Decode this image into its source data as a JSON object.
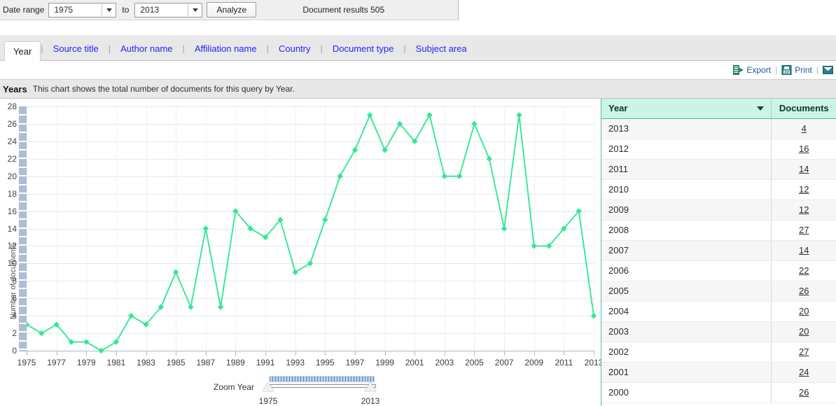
{
  "topbar": {
    "date_range_label": "Date range",
    "from_value": "1975",
    "to_label": "to",
    "to_value": "2013",
    "analyze_label": "Analyze",
    "results_text": "Document results 505"
  },
  "tabs": [
    {
      "label": "Year",
      "active": true
    },
    {
      "label": "Source title",
      "active": false
    },
    {
      "label": "Author name",
      "active": false
    },
    {
      "label": "Affiliation name",
      "active": false
    },
    {
      "label": "Country",
      "active": false
    },
    {
      "label": "Document type",
      "active": false
    },
    {
      "label": "Subject area",
      "active": false
    }
  ],
  "actions": [
    {
      "label": "Export",
      "icon": "export-icon"
    },
    {
      "label": "Print",
      "icon": "print-icon"
    },
    {
      "label": "",
      "icon": "email-icon"
    }
  ],
  "section": {
    "title": "Years",
    "description": "This chart shows the total number of documents for this query by Year."
  },
  "zoom_slider": {
    "label": "Zoom Year",
    "start_label": "1975",
    "end_label": "2013"
  },
  "table": {
    "columns": [
      "Year",
      "Documents"
    ],
    "rows": [
      {
        "year": "2013",
        "documents": "4"
      },
      {
        "year": "2012",
        "documents": "16"
      },
      {
        "year": "2011",
        "documents": "14"
      },
      {
        "year": "2010",
        "documents": "12"
      },
      {
        "year": "2009",
        "documents": "12"
      },
      {
        "year": "2008",
        "documents": "27"
      },
      {
        "year": "2007",
        "documents": "14"
      },
      {
        "year": "2006",
        "documents": "22"
      },
      {
        "year": "2005",
        "documents": "26"
      },
      {
        "year": "2004",
        "documents": "20"
      },
      {
        "year": "2003",
        "documents": "20"
      },
      {
        "year": "2002",
        "documents": "27"
      },
      {
        "year": "2001",
        "documents": "24"
      },
      {
        "year": "2000",
        "documents": "26"
      }
    ]
  },
  "colors": {
    "series": "#34e894",
    "tab_link": "#2424ef",
    "table_header": "#c9f4e6",
    "action_link": "#1b5a9a"
  },
  "chart_data": {
    "type": "line",
    "title": "",
    "xlabel": "",
    "ylabel": "Number of documents",
    "xlim": [
      1975,
      2013
    ],
    "ylim": [
      0,
      28
    ],
    "ytick_step": 2,
    "xtick_step": 2,
    "grid": true,
    "legend": "none",
    "x": [
      1975,
      1976,
      1977,
      1978,
      1979,
      1980,
      1981,
      1982,
      1983,
      1984,
      1985,
      1986,
      1987,
      1988,
      1989,
      1990,
      1991,
      1992,
      1993,
      1994,
      1995,
      1996,
      1997,
      1998,
      1999,
      2000,
      2001,
      2002,
      2003,
      2004,
      2005,
      2006,
      2007,
      2008,
      2009,
      2010,
      2011,
      2012,
      2013
    ],
    "values": [
      3,
      2,
      3,
      1,
      1,
      0,
      1,
      4,
      3,
      5,
      9,
      5,
      14,
      5,
      16,
      14,
      13,
      15,
      9,
      10,
      15,
      20,
      23,
      27,
      23,
      26,
      24,
      27,
      20,
      20,
      26,
      22,
      14,
      27,
      12,
      12,
      14,
      16,
      4
    ],
    "xtick_labels": [
      "1975",
      "1977",
      "1979",
      "1981",
      "1983",
      "1985",
      "1987",
      "1989",
      "1991",
      "1993",
      "1995",
      "1997",
      "1999",
      "2001",
      "2003",
      "2005",
      "2007",
      "2009",
      "2011",
      "2013"
    ],
    "ytick_labels": [
      "0",
      "2",
      "4",
      "6",
      "8",
      "10",
      "12",
      "14",
      "16",
      "18",
      "20",
      "22",
      "24",
      "26",
      "28"
    ]
  }
}
